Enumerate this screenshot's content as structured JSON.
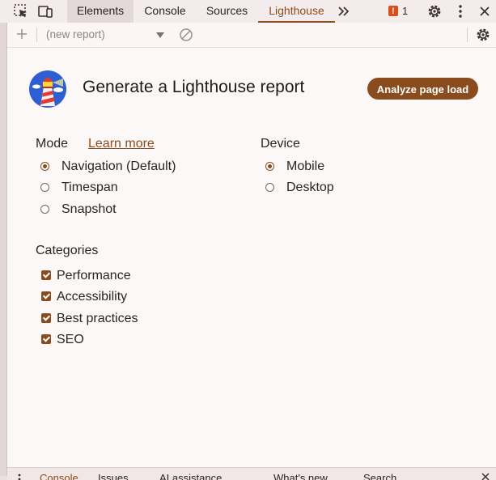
{
  "tabs": {
    "elements": "Elements",
    "console": "Console",
    "sources": "Sources",
    "lighthouse": "Lighthouse"
  },
  "issues": {
    "count": "1"
  },
  "toolbar": {
    "report_select": "(new report)"
  },
  "header": {
    "title": "Generate a Lighthouse report",
    "analyze_button": "Analyze page load"
  },
  "mode": {
    "label": "Mode",
    "learn_more": "Learn more",
    "options": [
      {
        "label": "Navigation (Default)",
        "checked": true
      },
      {
        "label": "Timespan",
        "checked": false
      },
      {
        "label": "Snapshot",
        "checked": false
      }
    ]
  },
  "device": {
    "label": "Device",
    "options": [
      {
        "label": "Mobile",
        "checked": true
      },
      {
        "label": "Desktop",
        "checked": false
      }
    ]
  },
  "categories": {
    "label": "Categories",
    "items": [
      {
        "label": "Performance",
        "checked": true
      },
      {
        "label": "Accessibility",
        "checked": true
      },
      {
        "label": "Best practices",
        "checked": true
      },
      {
        "label": "SEO",
        "checked": true
      }
    ]
  },
  "drawer": {
    "tabs": [
      "Console",
      "Issues",
      "AI assistance",
      "What's new",
      "Search"
    ]
  },
  "colors": {
    "accent": "#8a4c1c",
    "background": "#fdf8f8"
  }
}
